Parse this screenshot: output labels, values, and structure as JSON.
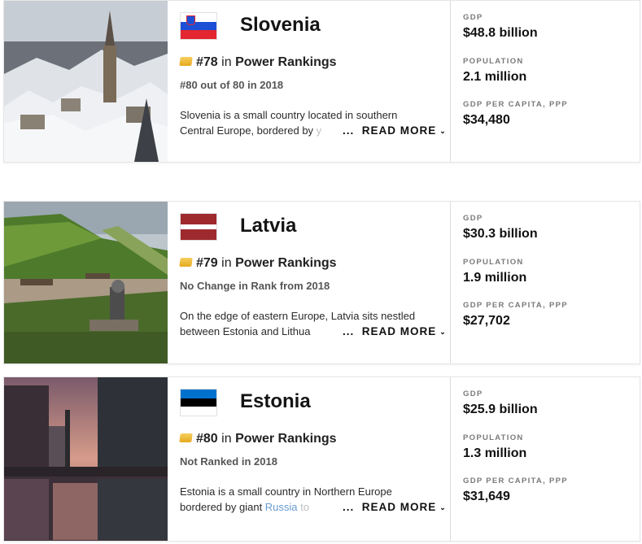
{
  "countries": [
    {
      "name": "Slovenia",
      "flag_colors": [
        "#ffffff",
        "#1c4fd6",
        "#e3262f"
      ],
      "rank_number": "#78",
      "rank_in": "in",
      "rank_label": "Power Rankings",
      "rank_change": "#80 out of 80 in 2018",
      "description_line1": "Slovenia is a small country located in southern",
      "description_line2": "Central Europe, bordered by",
      "description_link": "",
      "description_fade": "",
      "ellipsis": "...",
      "read_more": "READ MORE",
      "stats": {
        "gdp_label": "GDP",
        "gdp_value": "$48.8 billion",
        "population_label": "POPULATION",
        "population_value": "2.1 million",
        "gdp_ppp_label": "GDP PER CAPITA, PPP",
        "gdp_ppp_value": "$34,480"
      }
    },
    {
      "name": "Latvia",
      "flag_colors": [
        "#9e2a2e",
        "#ffffff",
        "#9e2a2e"
      ],
      "rank_number": "#79",
      "rank_in": "in",
      "rank_label": "Power Rankings",
      "rank_change": "No Change in Rank from 2018",
      "description_line1": "On the edge of eastern Europe, Latvia sits nestled",
      "description_line2": "between Estonia and Lithua",
      "description_link": "",
      "description_fade": "",
      "ellipsis": "...",
      "read_more": "READ MORE",
      "stats": {
        "gdp_label": "GDP",
        "gdp_value": "$30.3 billion",
        "population_label": "POPULATION",
        "population_value": "1.9 million",
        "gdp_ppp_label": "GDP PER CAPITA, PPP",
        "gdp_ppp_value": "$27,702"
      }
    },
    {
      "name": "Estonia",
      "flag_colors": [
        "#0072ce",
        "#000000",
        "#ffffff"
      ],
      "rank_number": "#80",
      "rank_in": "in",
      "rank_label": "Power Rankings",
      "rank_change": "Not Ranked in 2018",
      "description_line1": "Estonia is a small country in Northern Europe",
      "description_line2": "bordered by giant ",
      "description_link": "Russia",
      "description_fade": " to",
      "ellipsis": "...",
      "read_more": "READ MORE",
      "stats": {
        "gdp_label": "GDP",
        "gdp_value": "$25.9 billion",
        "population_label": "POPULATION",
        "population_value": "1.3 million",
        "gdp_ppp_label": "GDP PER CAPITA, PPP",
        "gdp_ppp_value": "$31,649"
      }
    }
  ]
}
